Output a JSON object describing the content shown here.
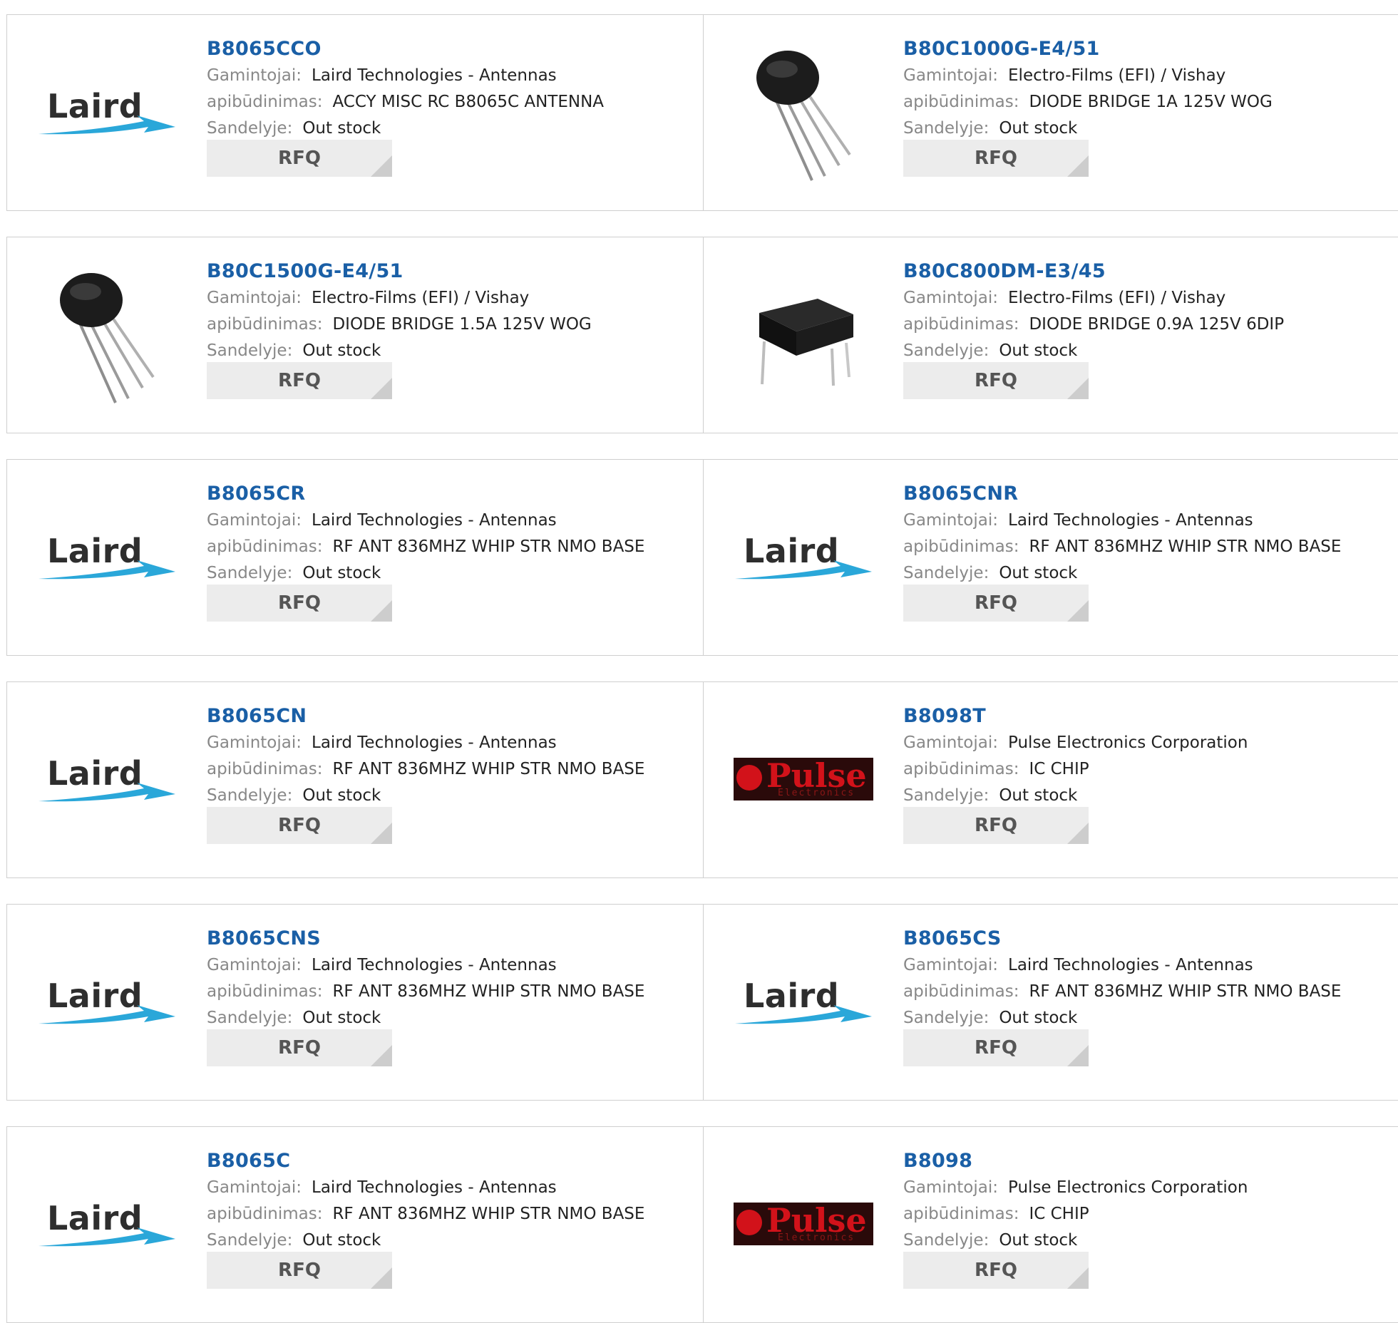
{
  "labels": {
    "manufacturer": "Gamintojai:",
    "description": "apibūdinimas:",
    "stock": "Sandelyje:",
    "rfq": "RFQ"
  },
  "logo_text": {
    "laird": "Laird",
    "pulse": "Pulse",
    "pulse_sub": "Electronics"
  },
  "colors": {
    "title": "#1a5fa6",
    "rfq_bg": "#ececec",
    "border": "#cfcfcf"
  },
  "products": [
    {
      "part": "B8065CCO",
      "manufacturer": "Laird Technologies - Antennas",
      "description": "ACCY MISC RC B8065C ANTENNA",
      "stock": "Out stock",
      "image": "laird-logo"
    },
    {
      "part": "B80C1000G-E4/51",
      "manufacturer": "Electro-Films (EFI) / Vishay",
      "description": "DIODE BRIDGE 1A 125V WOG",
      "stock": "Out stock",
      "image": "round-diode-bridge"
    },
    {
      "part": "B80C1500G-E4/51",
      "manufacturer": "Electro-Films (EFI) / Vishay",
      "description": "DIODE BRIDGE 1.5A 125V WOG",
      "stock": "Out stock",
      "image": "round-diode-bridge"
    },
    {
      "part": "B80C800DM-E3/45",
      "manufacturer": "Electro-Films (EFI) / Vishay",
      "description": "DIODE BRIDGE 0.9A 125V 6DIP",
      "stock": "Out stock",
      "image": "dip-package"
    },
    {
      "part": "B8065CR",
      "manufacturer": "Laird Technologies - Antennas",
      "description": "RF ANT 836MHZ WHIP STR NMO BASE",
      "stock": "Out stock",
      "image": "laird-logo"
    },
    {
      "part": "B8065CNR",
      "manufacturer": "Laird Technologies - Antennas",
      "description": "RF ANT 836MHZ WHIP STR NMO BASE",
      "stock": "Out stock",
      "image": "laird-logo"
    },
    {
      "part": "B8065CN",
      "manufacturer": "Laird Technologies - Antennas",
      "description": "RF ANT 836MHZ WHIP STR NMO BASE",
      "stock": "Out stock",
      "image": "laird-logo"
    },
    {
      "part": "B8098T",
      "manufacturer": "Pulse Electronics Corporation",
      "description": "IC CHIP",
      "stock": "Out stock",
      "image": "pulse-logo"
    },
    {
      "part": "B8065CNS",
      "manufacturer": "Laird Technologies - Antennas",
      "description": "RF ANT 836MHZ WHIP STR NMO BASE",
      "stock": "Out stock",
      "image": "laird-logo"
    },
    {
      "part": "B8065CS",
      "manufacturer": "Laird Technologies - Antennas",
      "description": "RF ANT 836MHZ WHIP STR NMO BASE",
      "stock": "Out stock",
      "image": "laird-logo"
    },
    {
      "part": "B8065C",
      "manufacturer": "Laird Technologies - Antennas",
      "description": "RF ANT 836MHZ WHIP STR NMO BASE",
      "stock": "Out stock",
      "image": "laird-logo"
    },
    {
      "part": "B8098",
      "manufacturer": "Pulse Electronics Corporation",
      "description": "IC CHIP",
      "stock": "Out stock",
      "image": "pulse-logo"
    }
  ]
}
